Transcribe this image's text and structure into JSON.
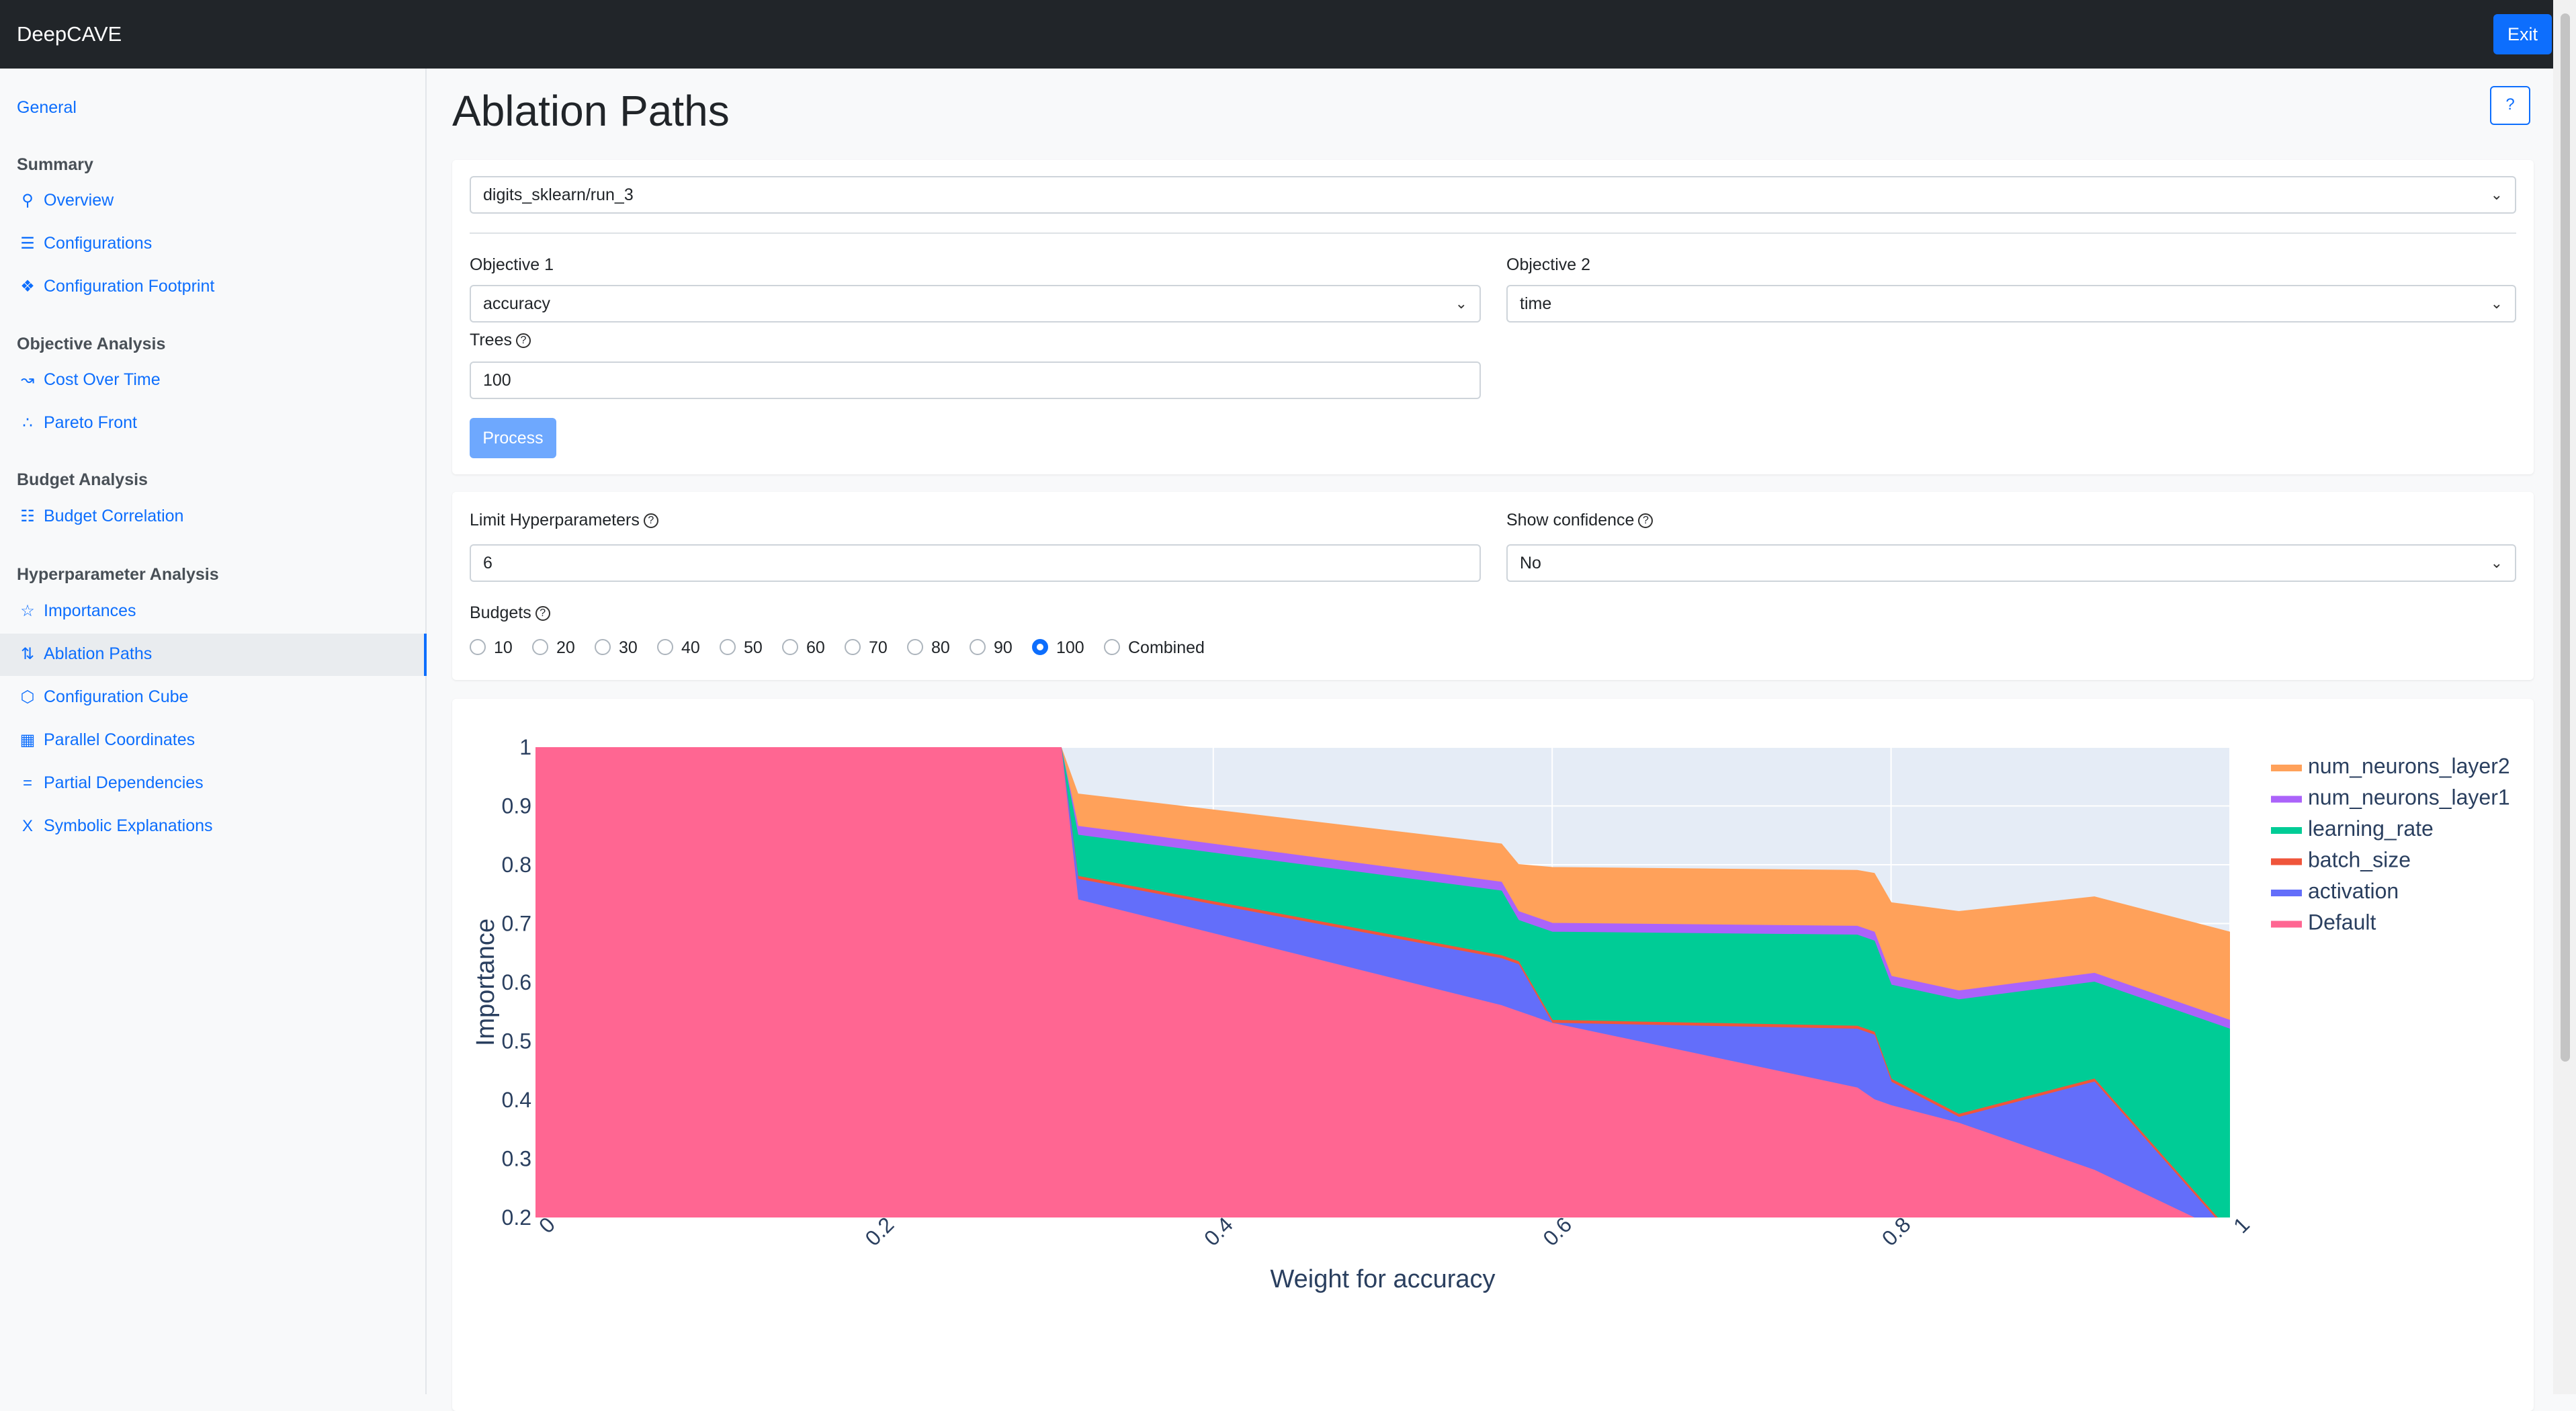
{
  "app": {
    "title": "DeepCAVE",
    "exit_label": "Exit"
  },
  "sidebar": {
    "general": "General",
    "sections": [
      {
        "heading": "Summary",
        "items": [
          "Overview",
          "Configurations",
          "Configuration Footprint"
        ]
      },
      {
        "heading": "Objective Analysis",
        "items": [
          "Cost Over Time",
          "Pareto Front"
        ]
      },
      {
        "heading": "Budget Analysis",
        "items": [
          "Budget Correlation"
        ]
      },
      {
        "heading": "Hyperparameter Analysis",
        "items": [
          "Importances",
          "Ablation Paths",
          "Configuration Cube",
          "Parallel Coordinates",
          "Partial Dependencies",
          "Symbolic Explanations"
        ]
      }
    ],
    "active": "Ablation Paths",
    "icons": [
      "search-icon",
      "sliders-icon",
      "footprint-icon",
      "line-chart-icon",
      "pareto-icon",
      "layers-icon",
      "star-icon",
      "sort-icon",
      "cube-icon",
      "map-icon",
      "equals-icon",
      "symbolic-icon"
    ]
  },
  "page": {
    "title": "Ablation Paths"
  },
  "inputs": {
    "run": "digits_sklearn/run_3",
    "objective1_label": "Objective 1",
    "objective1": "accuracy",
    "objective2_label": "Objective 2",
    "objective2": "time",
    "trees_label": "Trees",
    "trees": "100",
    "process_label": "Process"
  },
  "filters": {
    "limit_label": "Limit Hyperparameters",
    "limit": "6",
    "confidence_label": "Show confidence",
    "confidence": "No",
    "budgets_label": "Budgets",
    "budgets": [
      "10",
      "20",
      "30",
      "40",
      "50",
      "60",
      "70",
      "80",
      "90",
      "100",
      "Combined"
    ],
    "selected_budget": "100"
  },
  "chart_data": {
    "type": "area",
    "xlabel": "Weight for accuracy",
    "ylabel": "Importance",
    "xlim": [
      0,
      1
    ],
    "ylim": [
      0.2,
      1
    ],
    "x_ticks": [
      "0",
      "0.2",
      "0.4",
      "0.6",
      "0.8",
      "1"
    ],
    "y_ticks": [
      "0.2",
      "0.3",
      "0.4",
      "0.5",
      "0.6",
      "0.7",
      "0.8",
      "0.9",
      "1"
    ],
    "legend_position": "right",
    "x": [
      0,
      0.31,
      0.32,
      0.57,
      0.58,
      0.6,
      0.78,
      0.79,
      0.8,
      0.84,
      0.92,
      1
    ],
    "series": [
      {
        "name": "Default",
        "color": "#ff6692",
        "values": [
          1,
          1,
          0.74,
          0.56,
          0.55,
          0.53,
          0.42,
          0.4,
          0.39,
          0.36,
          0.28,
          0.17
        ]
      },
      {
        "name": "activation",
        "color": "#636efa",
        "values": [
          1,
          1,
          0.775,
          0.64,
          0.63,
          0.53,
          0.52,
          0.51,
          0.43,
          0.37,
          0.43,
          0.17
        ]
      },
      {
        "name": "batch_size",
        "color": "#ef553b",
        "values": [
          1,
          1,
          0.78,
          0.645,
          0.635,
          0.535,
          0.525,
          0.515,
          0.435,
          0.375,
          0.435,
          0.175
        ]
      },
      {
        "name": "learning_rate",
        "color": "#00cc96",
        "values": [
          1,
          1,
          0.85,
          0.755,
          0.705,
          0.685,
          0.68,
          0.67,
          0.595,
          0.57,
          0.6,
          0.52
        ]
      },
      {
        "name": "num_neurons_layer1",
        "color": "#ab63fa",
        "values": [
          1,
          1,
          0.865,
          0.77,
          0.72,
          0.7,
          0.695,
          0.685,
          0.61,
          0.585,
          0.615,
          0.535
        ]
      },
      {
        "name": "num_neurons_layer2",
        "color": "#ffa15a",
        "values": [
          1,
          1,
          0.92,
          0.835,
          0.8,
          0.795,
          0.79,
          0.785,
          0.735,
          0.72,
          0.745,
          0.685
        ]
      }
    ],
    "legend_order": [
      "num_neurons_layer2",
      "num_neurons_layer1",
      "learning_rate",
      "batch_size",
      "activation",
      "Default"
    ],
    "plot_bg": "#e5ecf6"
  }
}
